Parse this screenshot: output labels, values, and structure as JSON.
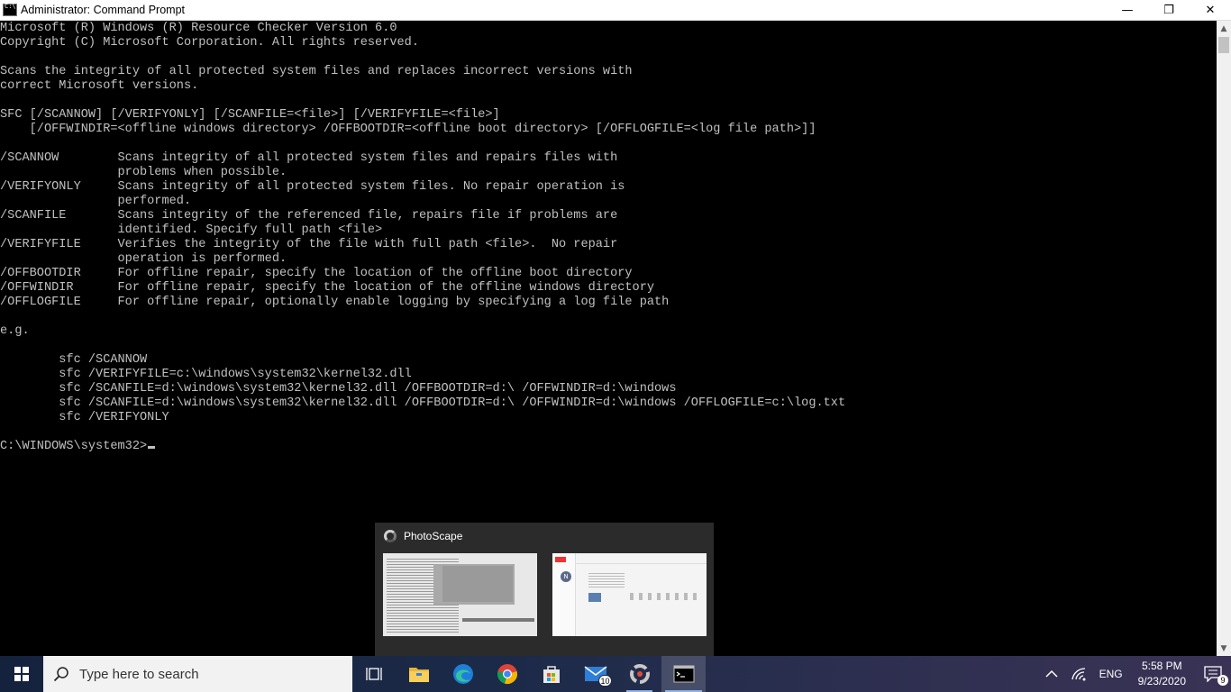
{
  "window": {
    "title": "Administrator: Command Prompt",
    "minimize": "—",
    "restore": "❐",
    "close": "✕"
  },
  "console": {
    "lines": [
      "Microsoft (R) Windows (R) Resource Checker Version 6.0",
      "Copyright (C) Microsoft Corporation. All rights reserved.",
      "",
      "Scans the integrity of all protected system files and replaces incorrect versions with",
      "correct Microsoft versions.",
      "",
      "SFC [/SCANNOW] [/VERIFYONLY] [/SCANFILE=<file>] [/VERIFYFILE=<file>]",
      "    [/OFFWINDIR=<offline windows directory> /OFFBOOTDIR=<offline boot directory> [/OFFLOGFILE=<log file path>]]",
      "",
      "/SCANNOW        Scans integrity of all protected system files and repairs files with",
      "                problems when possible.",
      "/VERIFYONLY     Scans integrity of all protected system files. No repair operation is",
      "                performed.",
      "/SCANFILE       Scans integrity of the referenced file, repairs file if problems are",
      "                identified. Specify full path <file>",
      "/VERIFYFILE     Verifies the integrity of the file with full path <file>.  No repair",
      "                operation is performed.",
      "/OFFBOOTDIR     For offline repair, specify the location of the offline boot directory",
      "/OFFWINDIR      For offline repair, specify the location of the offline windows directory",
      "/OFFLOGFILE     For offline repair, optionally enable logging by specifying a log file path",
      "",
      "e.g.",
      "",
      "        sfc /SCANNOW",
      "        sfc /VERIFYFILE=c:\\windows\\system32\\kernel32.dll",
      "        sfc /SCANFILE=d:\\windows\\system32\\kernel32.dll /OFFBOOTDIR=d:\\ /OFFWINDIR=d:\\windows",
      "        sfc /SCANFILE=d:\\windows\\system32\\kernel32.dll /OFFBOOTDIR=d:\\ /OFFWINDIR=d:\\windows /OFFLOGFILE=c:\\log.txt",
      "        sfc /VERIFYONLY",
      ""
    ],
    "prompt": "C:\\WINDOWS\\system32>"
  },
  "preview": {
    "app_name": "PhotoScape",
    "thumb2_avatar": "N"
  },
  "taskbar": {
    "search_placeholder": "Type here to search",
    "mail_count": "10",
    "language": "ENG",
    "time": "5:58 PM",
    "date": "9/23/2020",
    "notification_count": "9"
  },
  "colors": {
    "console_bg": "#000000",
    "console_text": "#c0c0c0",
    "taskbar_start": "#15223d",
    "taskbar_end": "#3a3355"
  }
}
